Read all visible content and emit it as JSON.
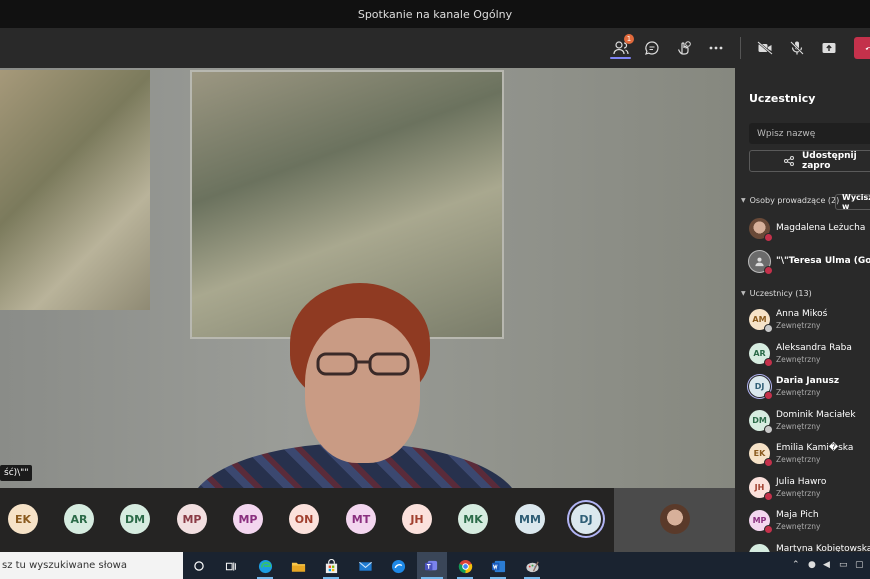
{
  "window": {
    "title": "Spotkanie na kanale Ogólny"
  },
  "toolbar": {
    "participants_badge": "1",
    "icons": [
      "participants-icon",
      "chat-icon",
      "reactions-icon",
      "more-icon",
      "camera-off-icon",
      "mic-off-icon",
      "share-screen-icon",
      "leave-icon"
    ]
  },
  "video": {
    "name_tag": "ść)\\\"\"",
    "avatars": [
      {
        "initials": "EK",
        "bg": "#f6e2c7",
        "fg": "#8a5a1e"
      },
      {
        "initials": "AR",
        "bg": "#d6ece0",
        "fg": "#2c6b49"
      },
      {
        "initials": "DM",
        "bg": "#d6ece0",
        "fg": "#2c6b49"
      },
      {
        "initials": "MP",
        "bg": "#f2dfe0",
        "fg": "#8a3b45"
      },
      {
        "initials": "MP",
        "bg": "#f3d6ef",
        "fg": "#8a2f7f"
      },
      {
        "initials": "ON",
        "bg": "#fbe1dc",
        "fg": "#a1402f"
      },
      {
        "initials": "MT",
        "bg": "#f3d6ef",
        "fg": "#8a2f7f"
      },
      {
        "initials": "JH",
        "bg": "#fbe1dc",
        "fg": "#a1402f"
      },
      {
        "initials": "MK",
        "bg": "#d6ece0",
        "fg": "#2c6b49"
      },
      {
        "initials": "MM",
        "bg": "#dbe8ee",
        "fg": "#2f5e76"
      },
      {
        "initials": "DJ",
        "bg": "#dbe8ee",
        "fg": "#2f5e76"
      }
    ]
  },
  "panel": {
    "title": "Uczestnicy",
    "search_placeholder": "Wpisz nazwę",
    "share_label": "Udostępnij zapro",
    "presenters_header": "Osoby prowadzące (2)",
    "mute_all": "Wycisz w",
    "presenters": [
      {
        "name": "Magdalena Leżucha"
      },
      {
        "name": "\"\\\"Teresa Ulma (Gość)\\\""
      }
    ],
    "attendees_header": "Uczestnicy (13)",
    "attendees": [
      {
        "initials": "AM",
        "name": "Anna Mikoś",
        "sub": "Zewnętrzny",
        "bg": "#f6e2c7",
        "fg": "#8a5a1e",
        "dot": "#c8c8c8"
      },
      {
        "initials": "AR",
        "name": "Aleksandra Raba",
        "sub": "Zewnętrzny",
        "bg": "#d6ece0",
        "fg": "#2c6b49",
        "dot": "#c4314b"
      },
      {
        "initials": "DJ",
        "name": "Daria Janusz",
        "sub": "Zewnętrzny",
        "bg": "#dbe8ee",
        "fg": "#2f5e76",
        "dot": "#c4314b"
      },
      {
        "initials": "DM",
        "name": "Dominik Maciałek",
        "sub": "Zewnętrzny",
        "bg": "#d6ece0",
        "fg": "#2c6b49",
        "dot": "#c8c8c8"
      },
      {
        "initials": "EK",
        "name": "Emilia Kami�ska",
        "sub": "Zewnętrzny",
        "bg": "#f6e2c7",
        "fg": "#8a5a1e",
        "dot": "#c4314b"
      },
      {
        "initials": "JH",
        "name": "Julia Hawro",
        "sub": "Zewnętrzny",
        "bg": "#fbe1dc",
        "fg": "#a1402f",
        "dot": "#c4314b"
      },
      {
        "initials": "MP",
        "name": "Maja Pich",
        "sub": "Zewnętrzny",
        "bg": "#f3d6ef",
        "fg": "#8a2f7f",
        "dot": "#c4314b"
      },
      {
        "initials": "",
        "name": "Martyna Kobiętowska",
        "sub": "",
        "bg": "#d6ece0",
        "fg": "#2c6b49",
        "dot": "#c4314b"
      }
    ]
  },
  "taskbar": {
    "search_text": "sz tu wyszukiwane słowa",
    "apps": [
      "cortana-icon",
      "task-view-icon",
      "edge-icon",
      "file-explorer-icon",
      "store-icon",
      "mail-icon",
      "edge-legacy-icon",
      "teams-icon",
      "chrome-icon",
      "word-icon",
      "paint-icon"
    ]
  }
}
